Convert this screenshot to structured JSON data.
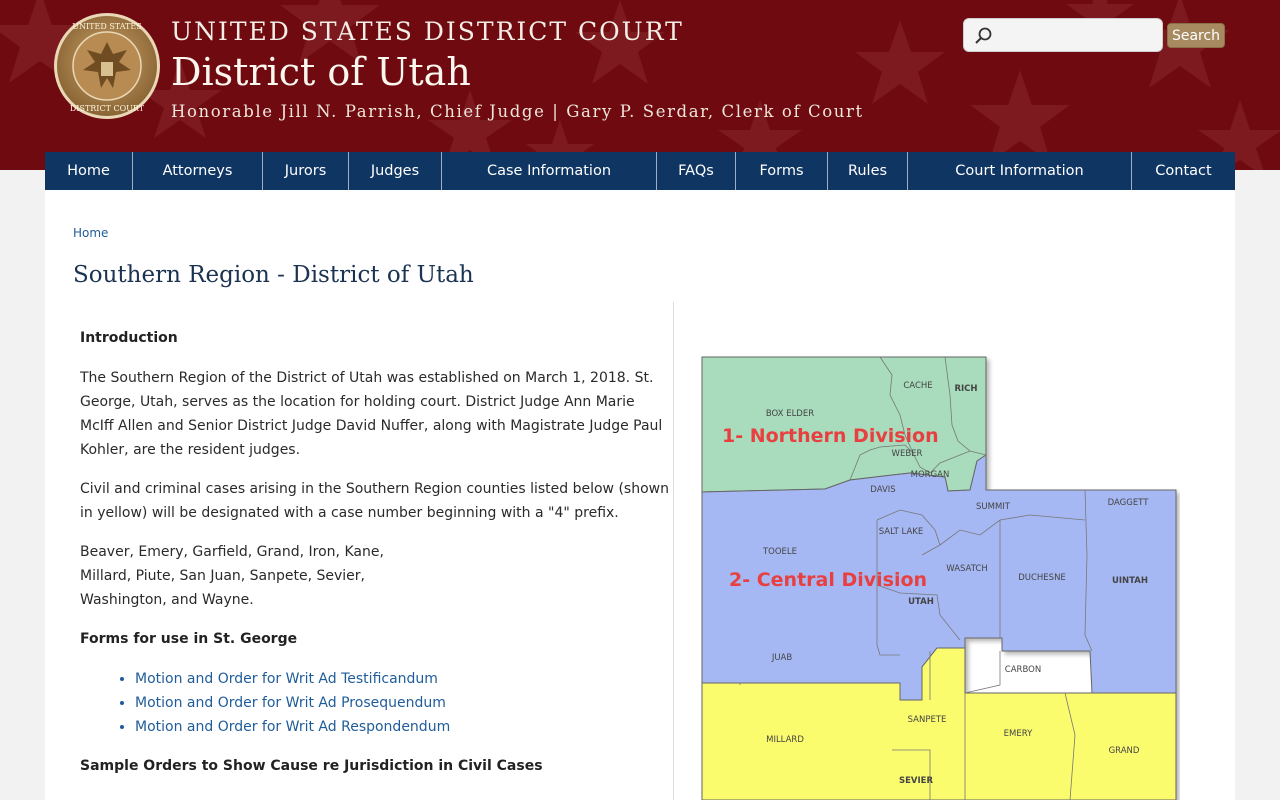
{
  "header": {
    "court_line": "UNITED STATES DISTRICT COURT",
    "district": "District of Utah",
    "judges_line": "Honorable Jill N. Parrish, Chief Judge | Gary P. Serdar, Clerk of Court",
    "seal_text_top": "UNITED STATES",
    "seal_text_bottom": "DISTRICT COURT"
  },
  "search": {
    "placeholder": "",
    "value": "",
    "button_label": "Search"
  },
  "nav": {
    "items": [
      "Home",
      "Attorneys",
      "Jurors",
      "Judges",
      "Case Information",
      "FAQs",
      "Forms",
      "Rules",
      "Court Information",
      "Contact"
    ]
  },
  "breadcrumb": {
    "home": "Home"
  },
  "page": {
    "title": "Southern Region - District of Utah",
    "intro_heading": "Introduction",
    "intro_p1": "The Southern Region of the District of Utah was established on March 1, 2018. St. George, Utah, serves as the location for holding court. District Judge Ann Marie McIff Allen and Senior District Judge David Nuffer, along with Magistrate Judge Paul Kohler, are the resident judges.",
    "intro_p2": "Civil and criminal cases arising in the Southern Region counties listed below (shown in yellow) will be designated with a case number beginning with a \"4\" prefix.",
    "counties_line1": "Beaver, Emery, Garfield, Grand, Iron, Kane,",
    "counties_line2": "Millard, Piute, San Juan, Sanpete, Sevier,",
    "counties_line3": "Washington, and Wayne.",
    "forms_heading": "Forms for use in St. George",
    "form_links": [
      "Motion and Order for Writ Ad Testificandum",
      "Motion and Order for Writ Ad Prosequendum",
      "Motion and Order for Writ Ad Respondendum"
    ],
    "sample_heading": "Sample Orders to Show Cause re Jurisdiction in Civil Cases"
  },
  "map": {
    "northern_label": "1- Northern Division",
    "central_label": "2- Central Division",
    "counties": {
      "cache": "CACHE",
      "rich": "RICH",
      "box_elder": "BOX ELDER",
      "weber": "WEBER",
      "morgan": "MORGAN",
      "davis": "DAVIS",
      "daggett": "DAGGETT",
      "summit": "SUMMIT",
      "salt_lake": "SALT LAKE",
      "tooele": "TOOELE",
      "wasatch": "WASATCH",
      "duchesne": "DUCHESNE",
      "uintah": "UINTAH",
      "utah": "UTAH",
      "juab": "JUAB",
      "carbon": "CARBON",
      "sanpete": "SANPETE",
      "millard": "MILLARD",
      "emery": "EMERY",
      "grand": "GRAND",
      "sevier": "SEVIER"
    },
    "colors": {
      "northern": "#a8dcbc",
      "central": "#a6b8f3",
      "southern": "#fbfb6e",
      "label": "#e84040"
    }
  }
}
